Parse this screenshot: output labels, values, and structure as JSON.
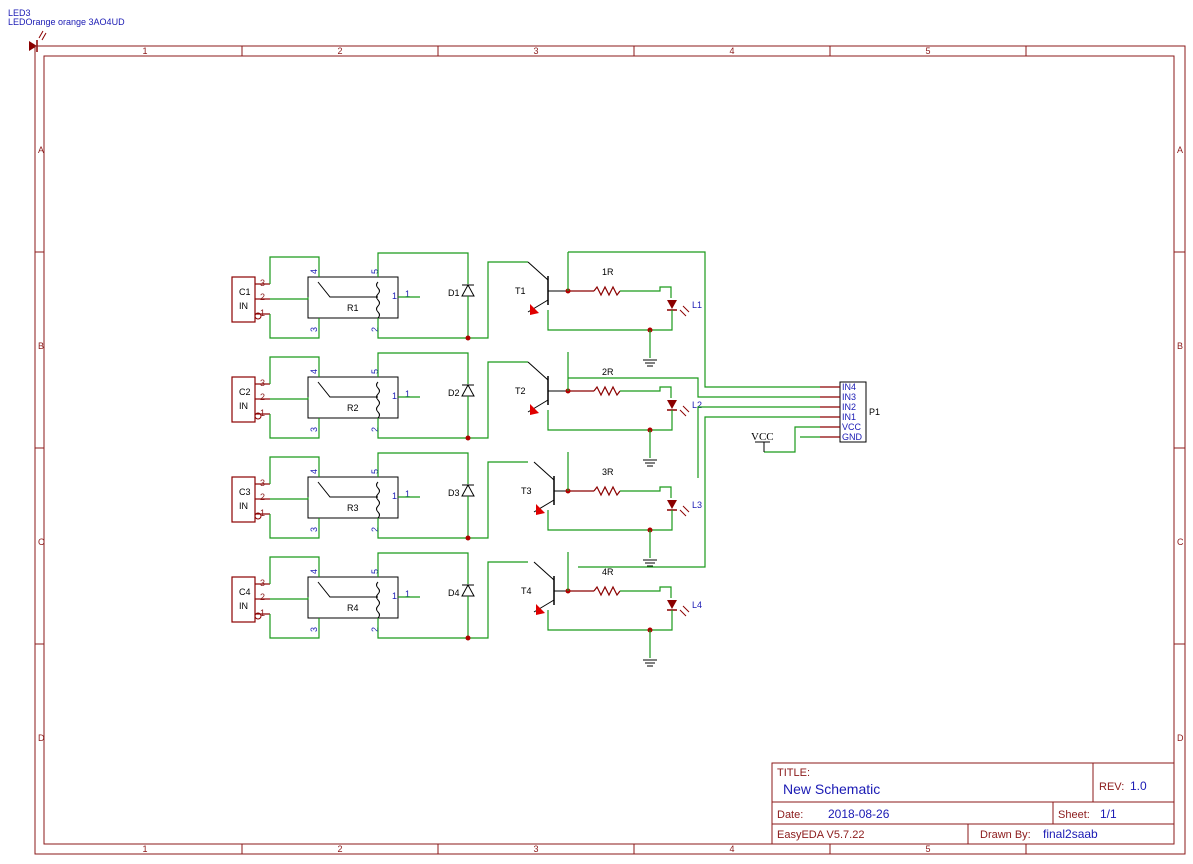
{
  "header_label": {
    "ref": "LED3",
    "value": "LEDOrange orange 3AO4UD"
  },
  "frame": {
    "columns": [
      "1",
      "2",
      "3",
      "4",
      "5"
    ],
    "rows": [
      "A",
      "B",
      "C",
      "D"
    ]
  },
  "titleblock": {
    "title_label": "TITLE:",
    "title_value": "New Schematic",
    "rev_label": "REV:",
    "rev_value": "1.0",
    "date_label": "Date:",
    "date_value": "2018-08-26",
    "sheet_label": "Sheet:",
    "sheet_value": "1/1",
    "tool_label": "EasyEDA V5.7.22",
    "drawn_label": "Drawn By:",
    "drawn_value": "final2saab"
  },
  "channels": [
    {
      "conn": "C1",
      "conn_sub": "IN",
      "relay": "R1",
      "diode": "D1",
      "transistor": "T1",
      "resistor": "1R",
      "led": "L1"
    },
    {
      "conn": "C2",
      "conn_sub": "IN",
      "relay": "R2",
      "diode": "D2",
      "transistor": "T2",
      "resistor": "2R",
      "led": "L2"
    },
    {
      "conn": "C3",
      "conn_sub": "IN",
      "relay": "R3",
      "diode": "D3",
      "transistor": "T3",
      "resistor": "3R",
      "led": "L3"
    },
    {
      "conn": "C4",
      "conn_sub": "IN",
      "relay": "R4",
      "diode": "D4",
      "transistor": "T4",
      "resistor": "4R",
      "led": "L4"
    }
  ],
  "pins": {
    "conn": [
      "3",
      "2",
      "1"
    ],
    "relay": [
      "4",
      "5",
      "1",
      "3",
      "2"
    ]
  },
  "header": {
    "ref": "P1",
    "pins": [
      "IN4",
      "IN3",
      "IN2",
      "IN1",
      "VCC",
      "GND"
    ]
  },
  "vcc_label": "VCC",
  "colors": {
    "frame": "#8b1a1a",
    "wire": "#1a9a1a",
    "part": "#8b0000",
    "text_blue": "#1a1ab4"
  }
}
